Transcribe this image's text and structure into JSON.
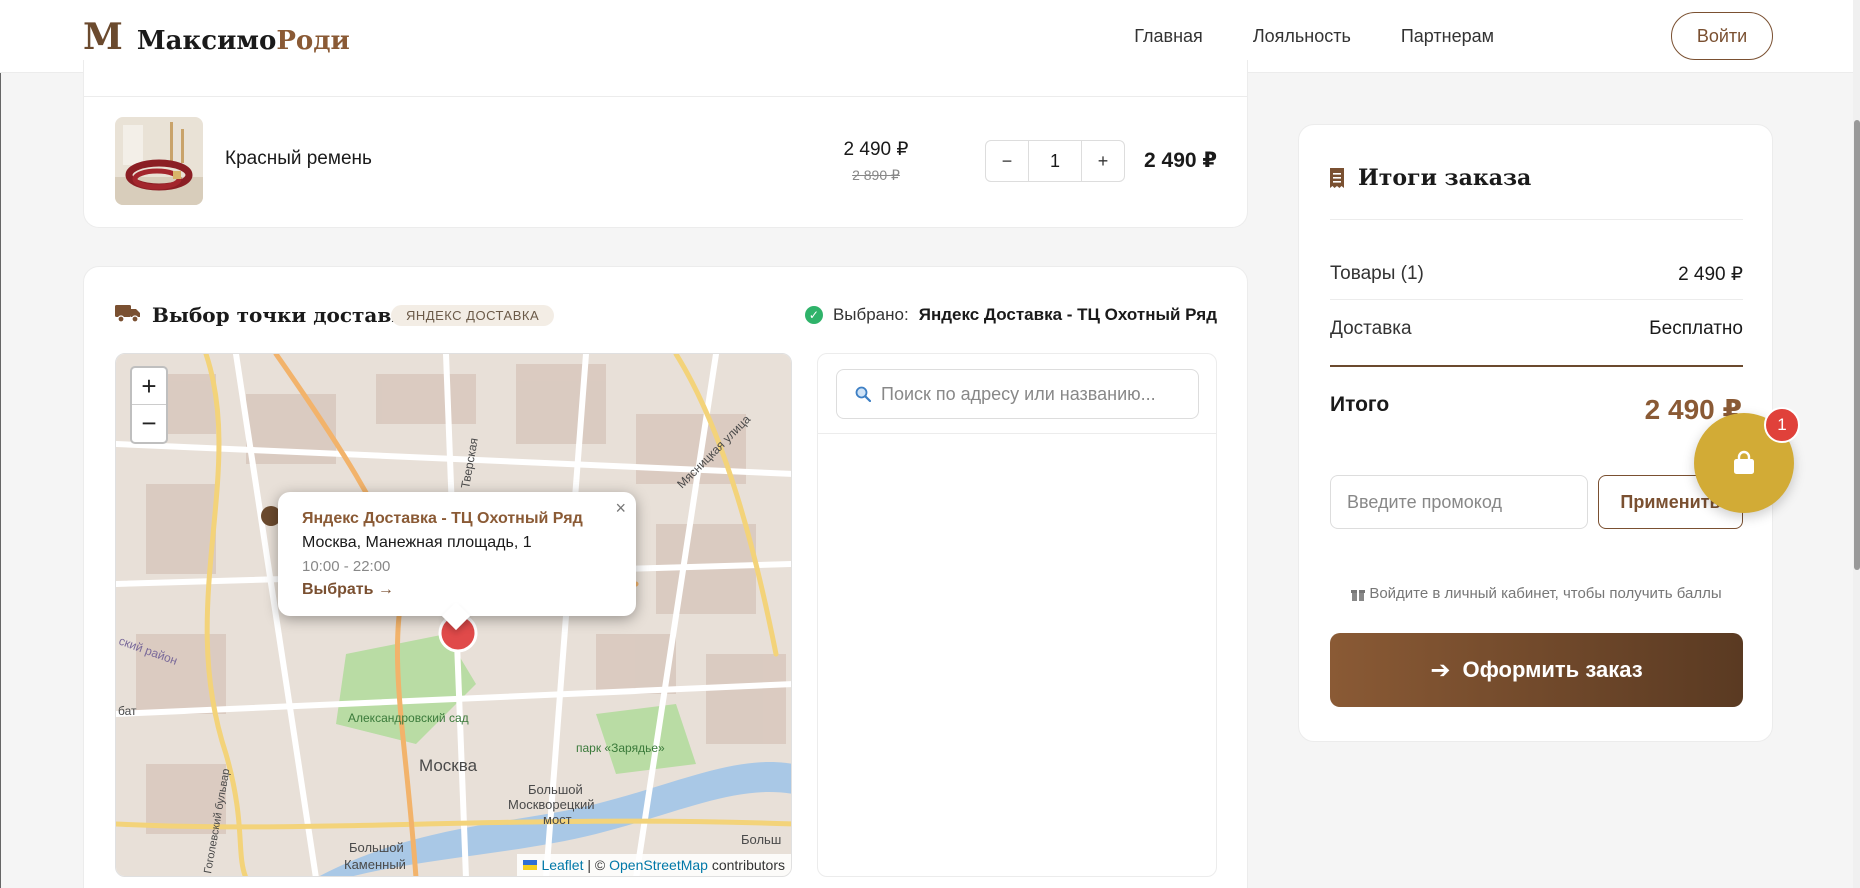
{
  "header": {
    "logo_mark": "M",
    "logo_part1": "Максимо",
    "logo_part2": "Роди",
    "nav": [
      "Главная",
      "Лояльность",
      "Партнерам"
    ],
    "login_label": "Войти"
  },
  "cart": {
    "item_name": "Красный ремень",
    "price": "2 490 ₽",
    "old_price": "2 890 ₽",
    "quantity": "1",
    "minus_label": "−",
    "plus_label": "+",
    "line_total": "2 490 ₽"
  },
  "delivery": {
    "title": "Выбор точки доставки",
    "badge": "ЯНДЕКС ДОСТАВКА",
    "selected_label": "Выбрано:",
    "selected_value": "Яндекс Доставка - ТЦ Охотный Ряд",
    "search_placeholder": "Поиск по адресу или названию...",
    "map": {
      "zoom_in": "+",
      "zoom_out": "−",
      "popup": {
        "close": "×",
        "title": "Яндекс Доставка - ТЦ Охотный Ряд",
        "address": "Москва, Манежная площадь, 1",
        "hours": "10:00 - 22:00",
        "select_link": "Выбрать →"
      },
      "labels": {
        "city": "Москва",
        "garden": "Александровский сад",
        "park": "парк «Зарядье»",
        "bridge1": "Большой",
        "bridge2": "Москворецкий",
        "bridge3": "мост",
        "big_stone1": "Большой",
        "big_stone2": "Каменный",
        "street1": "Тверская",
        "street2": "Мясницкая улица",
        "district": "ский район",
        "bat": "бат",
        "bolsh": "Больш",
        "blvd": "Гоголевский бульвар"
      },
      "attribution_leaflet": "Leaflet",
      "attribution_sep": "| ©",
      "attribution_osm": "OpenStreetMap",
      "attribution_tail": "contributors"
    }
  },
  "summary": {
    "title": "Итоги заказа",
    "goods_label": "Товары (1)",
    "goods_value": "2 490 ₽",
    "delivery_label": "Доставка",
    "delivery_value": "Бесплатно",
    "total_label": "Итого",
    "total_value": "2 490 ₽",
    "promo_placeholder": "Введите промокод",
    "promo_button": "Применить",
    "points_note": "Войдите в личный кабинет, чтобы получить баллы",
    "checkout_button": "Оформить заказ"
  },
  "floating_cart": {
    "count": "1"
  },
  "colors": {
    "brand": "#7a5031",
    "accent_gold": "#d2ab36",
    "badge_red": "#e0413a",
    "success": "#2fb36a"
  },
  "icons": {
    "truck": "truck-icon",
    "receipt": "receipt-icon",
    "search": "search-icon",
    "gift": "gift-icon",
    "arrow": "arrow-right-icon",
    "bag": "shopping-bag-icon",
    "check": "check-circle-icon"
  }
}
